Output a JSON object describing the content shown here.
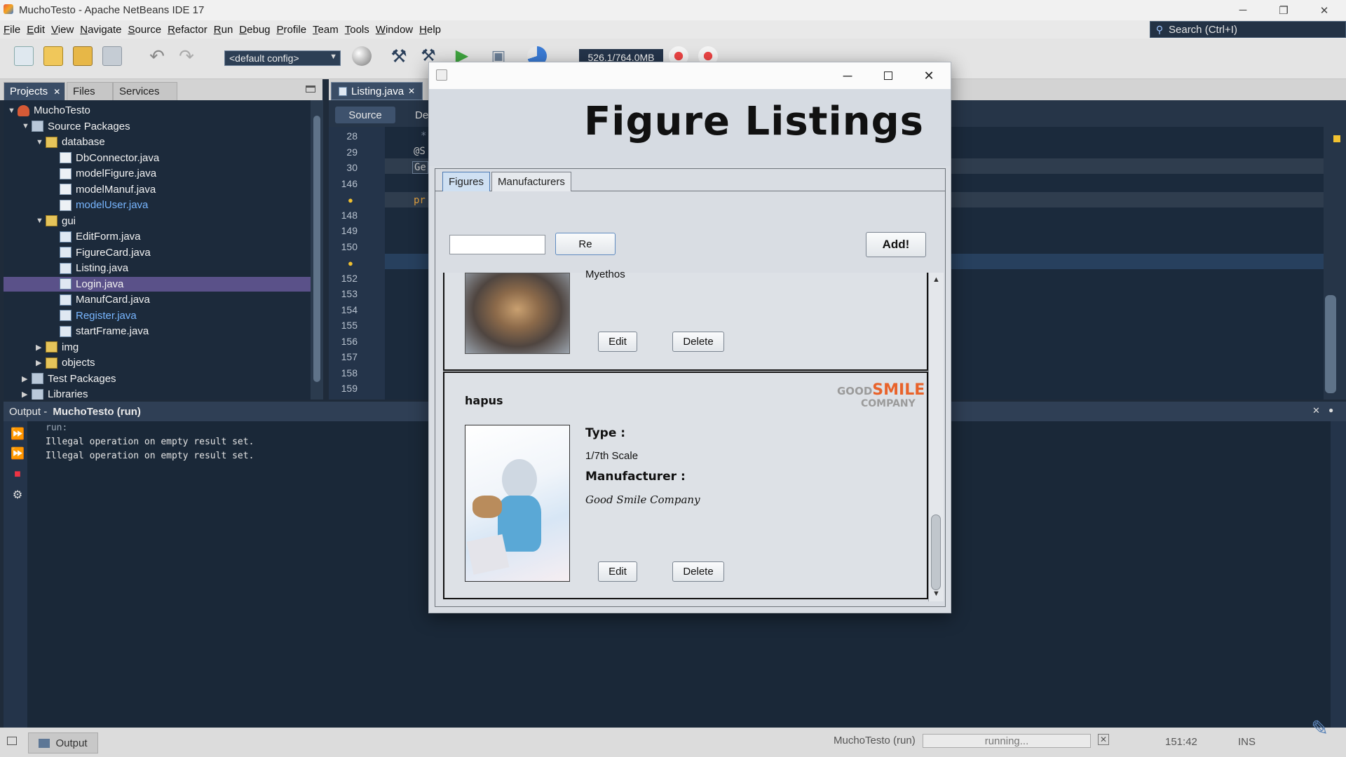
{
  "window": {
    "title": "MuchoTesto - Apache NetBeans IDE 17",
    "min_icon": "─",
    "restore_icon": "❐",
    "close_icon": "✕"
  },
  "menu": [
    "File",
    "Edit",
    "View",
    "Navigate",
    "Source",
    "Refactor",
    "Run",
    "Debug",
    "Profile",
    "Team",
    "Tools",
    "Window",
    "Help"
  ],
  "search": {
    "placeholder": "Search (Ctrl+I)"
  },
  "toolbar": {
    "config": "<default config>",
    "memory": "526.1/764.0MB"
  },
  "projects_panel": {
    "tabs": [
      "Projects",
      "Files",
      "Services"
    ],
    "tree": [
      {
        "label": "MuchoTesto",
        "level": 0,
        "exp": "▼",
        "icon": "proj"
      },
      {
        "label": "Source Packages",
        "level": 1,
        "exp": "▼",
        "icon": "pkgs"
      },
      {
        "label": "database",
        "level": 2,
        "exp": "▼",
        "icon": "pkg"
      },
      {
        "label": "DbConnector.java",
        "level": 3,
        "exp": "",
        "icon": "java"
      },
      {
        "label": "modelFigure.java",
        "level": 3,
        "exp": "",
        "icon": "java"
      },
      {
        "label": "modelManuf.java",
        "level": 3,
        "exp": "",
        "icon": "java"
      },
      {
        "label": "modelUser.java",
        "level": 3,
        "exp": "",
        "icon": "java",
        "blue": true
      },
      {
        "label": "gui",
        "level": 2,
        "exp": "▼",
        "icon": "pkg"
      },
      {
        "label": "EditForm.java",
        "level": 3,
        "exp": "",
        "icon": "form"
      },
      {
        "label": "FigureCard.java",
        "level": 3,
        "exp": "",
        "icon": "form"
      },
      {
        "label": "Listing.java",
        "level": 3,
        "exp": "",
        "icon": "form"
      },
      {
        "label": "Login.java",
        "level": 3,
        "exp": "",
        "icon": "form",
        "selected": true
      },
      {
        "label": "ManufCard.java",
        "level": 3,
        "exp": "",
        "icon": "form"
      },
      {
        "label": "Register.java",
        "level": 3,
        "exp": "",
        "icon": "form",
        "blue": true
      },
      {
        "label": "startFrame.java",
        "level": 3,
        "exp": "",
        "icon": "form"
      },
      {
        "label": "img",
        "level": 2,
        "exp": "▶",
        "icon": "pkg"
      },
      {
        "label": "objects",
        "level": 2,
        "exp": "▶",
        "icon": "pkg"
      },
      {
        "label": "Test Packages",
        "level": 1,
        "exp": "▶",
        "icon": "pkgs"
      },
      {
        "label": "Libraries",
        "level": 1,
        "exp": "▶",
        "icon": "pkgs"
      }
    ]
  },
  "editor": {
    "tab": "Listing.java",
    "source_btn": "Source",
    "design_btn": "De",
    "line_numbers": [
      "28",
      "29",
      "30",
      "146",
      "",
      "148",
      "149",
      "150",
      "",
      "152",
      "153",
      "154",
      "155",
      "156",
      "157",
      "158",
      "159"
    ],
    "code_snippets": [
      "*",
      "@S",
      "Ge",
      "pr"
    ]
  },
  "output": {
    "title_prefix": "Output - ",
    "title_bold": "MuchoTesto (run)",
    "lines": [
      "run:",
      "Illegal operation on empty result set.",
      "Illegal operation on empty result set."
    ]
  },
  "statusbar": {
    "output_btn": "Output",
    "task": "MuchoTesto (run)",
    "progress_text": "running...",
    "position": "151:42",
    "mode": "INS"
  },
  "dialog": {
    "heading": "Figure Listings",
    "tabs": [
      "Figures",
      "Manufacturers"
    ],
    "search_value": "",
    "refresh_label": "Re",
    "add_label": "Add!",
    "cards": [
      {
        "name": "",
        "manufacturer_partial": "Myethos",
        "edit_label": "Edit",
        "delete_label": "Delete"
      },
      {
        "name": "hapus",
        "type_label": "Type :",
        "type_value": "1/7th Scale",
        "manufacturer_label": "Manufacturer :",
        "manufacturer_value": "Good Smile Company",
        "logo_line1a": "GOOD",
        "logo_line1b": "SMILE",
        "logo_line2": "COMPANY",
        "edit_label": "Edit",
        "delete_label": "Delete"
      }
    ]
  },
  "colors": {
    "accent": "#3a4d66",
    "selection": "#5a5189",
    "link_blue": "#78b6ff",
    "logo_orange": "#e8632b"
  }
}
